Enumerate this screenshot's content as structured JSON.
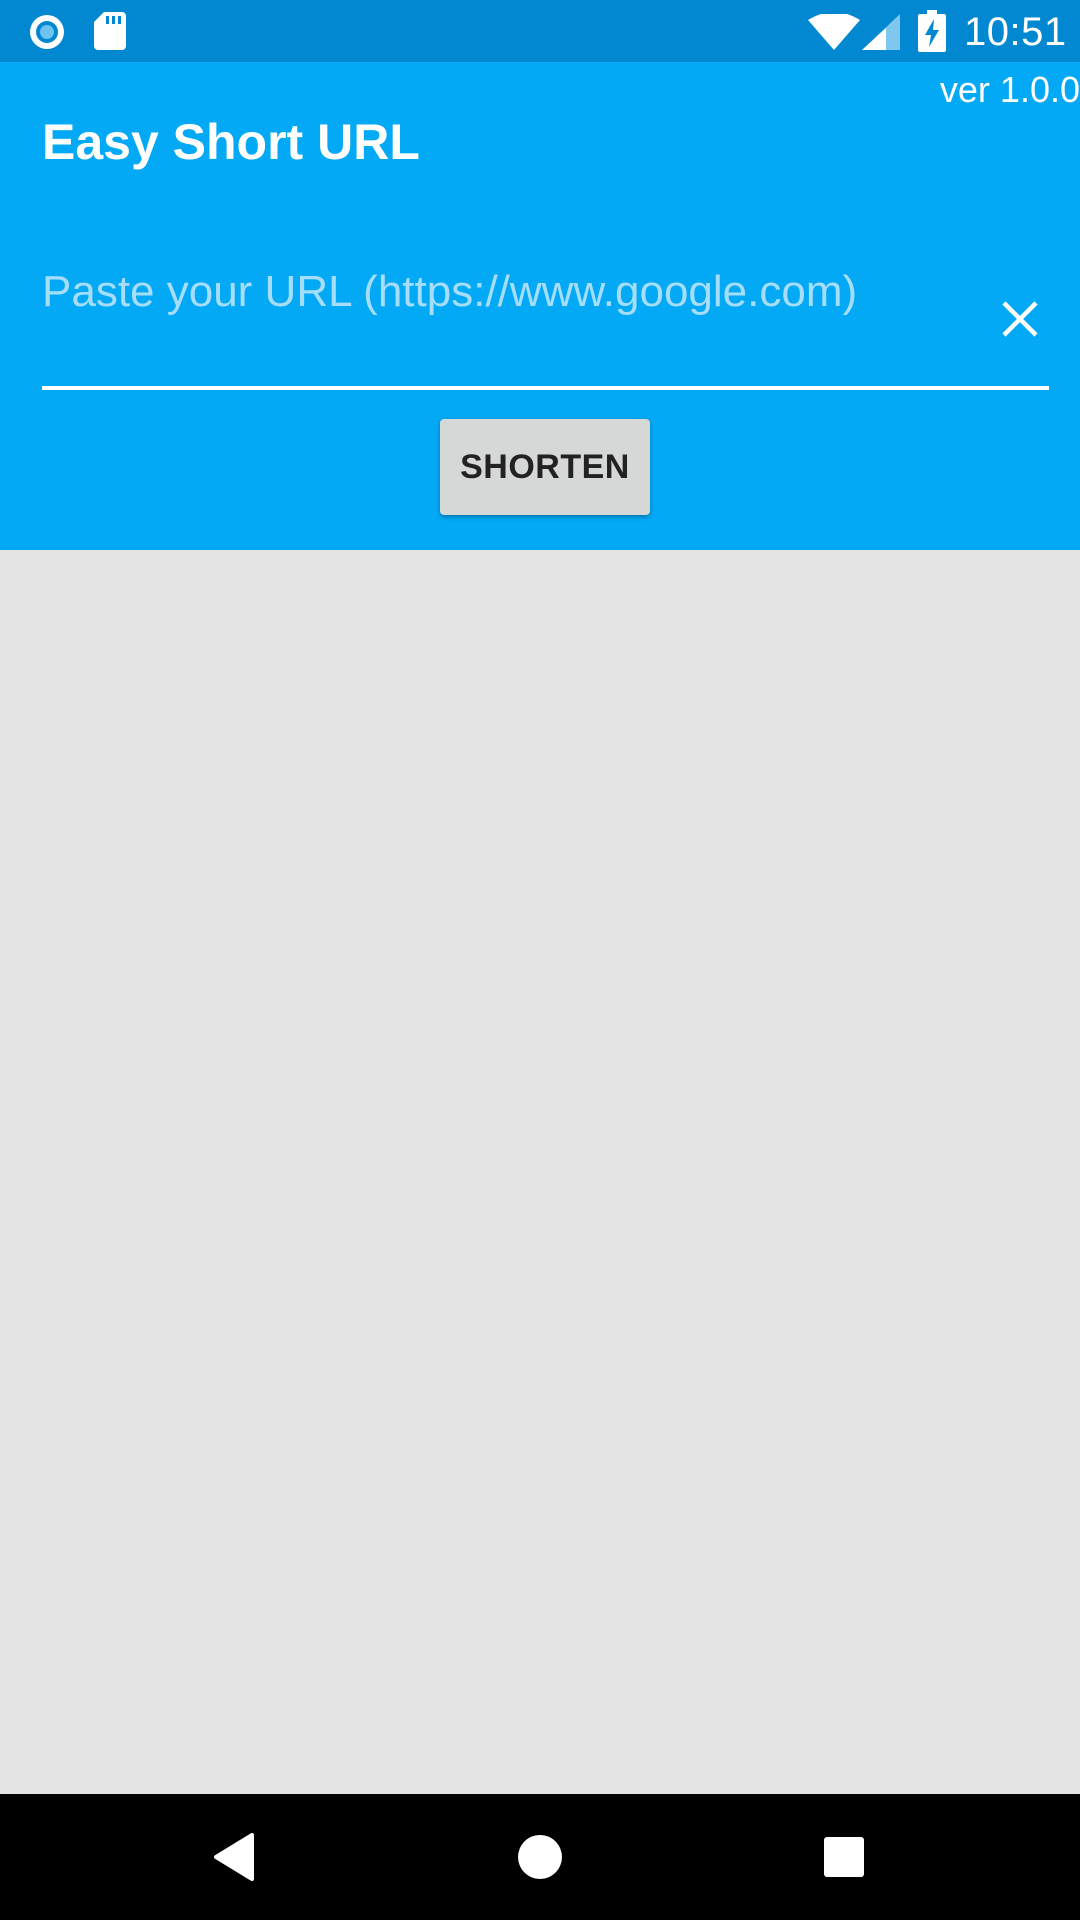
{
  "status_bar": {
    "time": "10:51",
    "icons": [
      "record-circle-icon",
      "sd-card-icon",
      "wifi-icon",
      "cell-signal-icon",
      "battery-charging-icon"
    ]
  },
  "header": {
    "title": "Easy Short URL",
    "version": "ver 1.0.0"
  },
  "url_input": {
    "value": "",
    "placeholder": "Paste your URL (https://www.google.com)",
    "clear_icon": "close-icon"
  },
  "shorten_button": {
    "label": "SHORTEN"
  },
  "nav_bar": {
    "icons": [
      "back-icon",
      "home-icon",
      "recents-icon"
    ]
  },
  "colors": {
    "status_bar": "#0288d1",
    "header": "#03a9f4",
    "content_background": "#e5e5e5",
    "button_background": "#d6d7d7",
    "placeholder_text": "#a6defa",
    "nav_bar": "#000000"
  }
}
